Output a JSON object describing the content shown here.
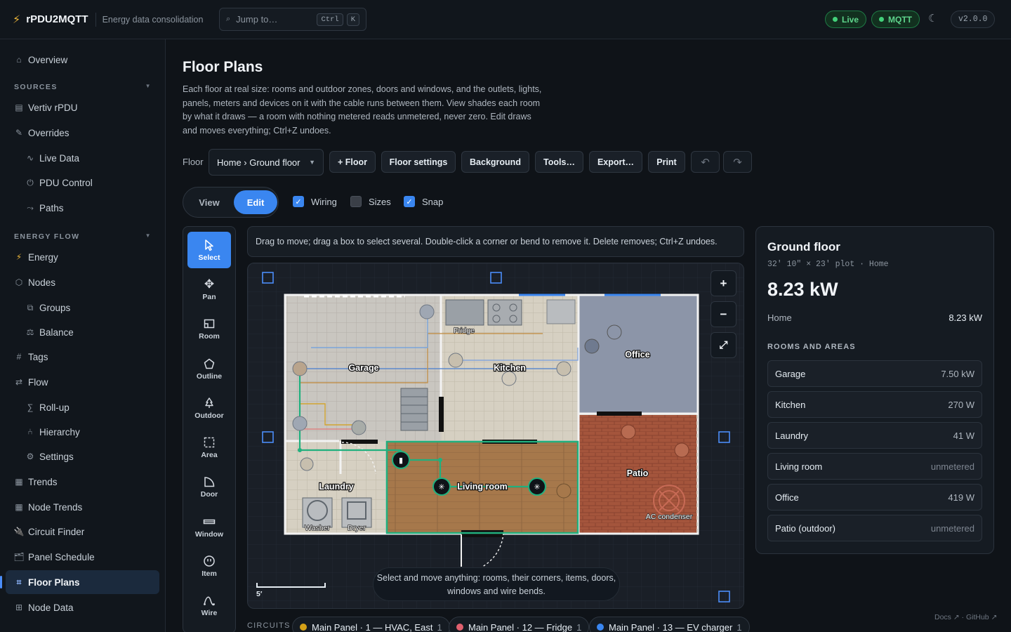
{
  "app": {
    "name": "rPDU2MQTT",
    "tagline": "Energy data consolidation",
    "version": "v2.0.0"
  },
  "search": {
    "placeholder": "Jump to…",
    "kbd1": "Ctrl",
    "kbd2": "K"
  },
  "status": {
    "live": "Live",
    "mqtt": "MQTT",
    "live_color": "#43d17a",
    "mqtt_color": "#43d17a"
  },
  "sidebar": {
    "overview": "Overview",
    "sources_title": "SOURCES",
    "vertiv": "Vertiv rPDU",
    "overrides": "Overrides",
    "live_data": "Live Data",
    "pdu_control": "PDU Control",
    "paths": "Paths",
    "energy_flow_title": "ENERGY FLOW",
    "energy": "Energy",
    "nodes": "Nodes",
    "groups": "Groups",
    "balance": "Balance",
    "tags": "Tags",
    "flow": "Flow",
    "rollup": "Roll-up",
    "hierarchy": "Hierarchy",
    "settings": "Settings",
    "trends": "Trends",
    "node_trends": "Node Trends",
    "circuit_finder": "Circuit Finder",
    "panel_schedule": "Panel Schedule",
    "floor_plans": "Floor Plans",
    "node_data": "Node Data"
  },
  "page": {
    "title": "Floor Plans",
    "description": "Each floor at real size: rooms and outdoor zones, doors and windows, and the outlets, lights, panels, meters and devices on it with the cable runs between them. View shades each room by what it draws — a room with nothing metered reads unmetered, never zero. Edit draws and moves everything; Ctrl+Z undoes."
  },
  "toolbar": {
    "floor_label": "Floor",
    "floor_value": "Home › Ground floor",
    "add_floor": "+ Floor",
    "floor_settings": "Floor settings",
    "background": "Background",
    "tools": "Tools…",
    "export": "Export…",
    "print": "Print",
    "undo": "↶",
    "redo": "↷"
  },
  "mode": {
    "view": "View",
    "edit": "Edit"
  },
  "options": {
    "wiring": "Wiring",
    "sizes": "Sizes",
    "snap": "Snap"
  },
  "tools": {
    "select": "Select",
    "pan": "Pan",
    "room": "Room",
    "outline": "Outline",
    "outdoor": "Outdoor",
    "area": "Area",
    "door": "Door",
    "window": "Window",
    "item": "Item",
    "wire": "Wire"
  },
  "hint": "Drag to move; drag a box to select several. Double-click a corner or bend to remove it. Delete removes; Ctrl+Z undoes.",
  "canvas": {
    "rooms": {
      "garage": "Garage",
      "kitchen": "Kitchen",
      "office": "Office",
      "laundry": "Laundry",
      "living_room": "Living room",
      "patio": "Patio"
    },
    "fixtures": {
      "fridge": "Fridge",
      "washer": "Washer",
      "dryer": "Dryer",
      "ac": "AC condenser"
    },
    "scale": "5′",
    "tip": "Select and move anything: rooms, their corners, items, doors, windows and wire bends.",
    "zoom_in": "+",
    "zoom_out": "−",
    "fit": "⤢"
  },
  "circuits": {
    "label": "CIRCUITS",
    "items": [
      {
        "name": "Main Panel · 1 — HVAC, East",
        "count": "1",
        "color": "#d4a017"
      },
      {
        "name": "Main Panel · 12 — Fridge",
        "count": "1",
        "color": "#e0606e"
      },
      {
        "name": "Main Panel · 13 — EV charger",
        "count": "1",
        "color": "#3a86f0"
      }
    ]
  },
  "panel": {
    "title": "Ground floor",
    "dimensions": "32′ 10″ × 23′ plot · Home",
    "power": "8.23 kW",
    "home_label": "Home",
    "home_value": "8.23 kW",
    "section": "ROOMS AND AREAS",
    "rooms": [
      {
        "name": "Garage",
        "value": "7.50 kW"
      },
      {
        "name": "Kitchen",
        "value": "270 W"
      },
      {
        "name": "Laundry",
        "value": "41 W"
      },
      {
        "name": "Living room",
        "value": "unmetered"
      },
      {
        "name": "Office",
        "value": "419 W"
      },
      {
        "name": "Patio (outdoor)",
        "value": "unmetered"
      }
    ]
  },
  "footer": "Docs ↗ · GitHub ↗"
}
